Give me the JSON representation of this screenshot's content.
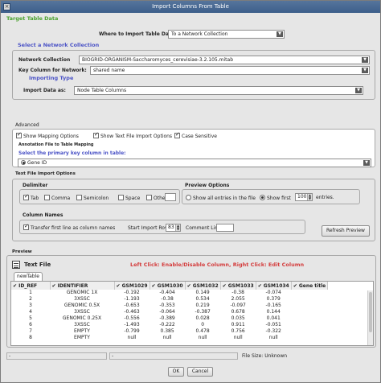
{
  "window": {
    "title": "Import Columns From Table",
    "close_icon": "close-icon"
  },
  "target": {
    "label": "Target Table Data",
    "where_label": "Where to Import Table Data",
    "where_value": "To a Network Collection"
  },
  "network": {
    "section_label": "Select a Network Collection",
    "collection_label": "Network Collection",
    "collection_value": "BIOGRID-ORGANISM-Saccharomyces_cerevisiae-3.2.105.mitab",
    "key_label": "Key Column for Network:",
    "key_value": "shared name"
  },
  "importing": {
    "label": "Importing Type",
    "import_as_label": "Import Data as:",
    "import_as_value": "Node Table Columns"
  },
  "advanced": {
    "label": "Advanced",
    "show_mapping": "Show Mapping Options",
    "show_text_file": "Show Text File Import Options",
    "case_sensitive": "Case Sensitive",
    "annotation_label": "Annotation File to Table Mapping",
    "primary_key_label": "Select the primary key column in table:",
    "primary_key_value": "Gene ID"
  },
  "text_file_options": {
    "label": "Text File Import Options",
    "delimiter_label": "Delimiter",
    "tab": "Tab",
    "comma": "Comma",
    "semicolon": "Semicolon",
    "space": "Space",
    "other": "Other",
    "preview_options_label": "Preview Options",
    "show_all": "Show all entries in the file",
    "show_first": "Show first",
    "show_first_value": "100",
    "entries": "entries.",
    "column_names_label": "Column Names",
    "transfer_first_line": "Transfer first line as column names",
    "start_import_row_label": "Start Import Row:",
    "start_import_row_value": "83",
    "comment_line_label": "Comment Line:",
    "refresh_preview": "Refresh Preview"
  },
  "preview": {
    "label": "Preview",
    "text_file_label": "Text File",
    "hint": "Left Click: Enable/Disable Column, Right Click: Edit Column",
    "tab": "newTable",
    "columns": [
      "ID_REF",
      "IDENTIFIER",
      "GSM1029",
      "GSM1030",
      "GSM1032",
      "GSM1033",
      "GSM1034",
      "Gene title"
    ],
    "rows": [
      [
        "1",
        "GENOMIC 1X",
        "-0.192",
        "-0.404",
        "0.149",
        "-0.38",
        "-0.074",
        ""
      ],
      [
        "2",
        "3XSSC",
        "-1.193",
        "-0.38",
        "0.534",
        "2.055",
        "0.379",
        ""
      ],
      [
        "3",
        "GENOMIC 0.5X",
        "-0.653",
        "-0.353",
        "0.219",
        "-0.097",
        "-0.165",
        ""
      ],
      [
        "4",
        "3XSSC",
        "-0.463",
        "-0.064",
        "-0.387",
        "0.678",
        "0.144",
        ""
      ],
      [
        "5",
        "GENOMIC 0.25X",
        "-0.556",
        "-0.389",
        "0.028",
        "0.035",
        "0.041",
        ""
      ],
      [
        "6",
        "3XSSC",
        "-1.493",
        "-0.222",
        "0",
        "0.911",
        "-0.051",
        ""
      ],
      [
        "7",
        "EMPTY",
        "-0.799",
        "0.385",
        "0.478",
        "0.756",
        "-0.322",
        ""
      ],
      [
        "8",
        "EMPTY",
        "null",
        "null",
        "null",
        "null",
        "null",
        ""
      ]
    ]
  },
  "status": {
    "left_value": "-",
    "mid_value": "-",
    "file_size": "File Size: Unknown"
  },
  "footer": {
    "ok": "OK",
    "cancel": "Cancel"
  }
}
